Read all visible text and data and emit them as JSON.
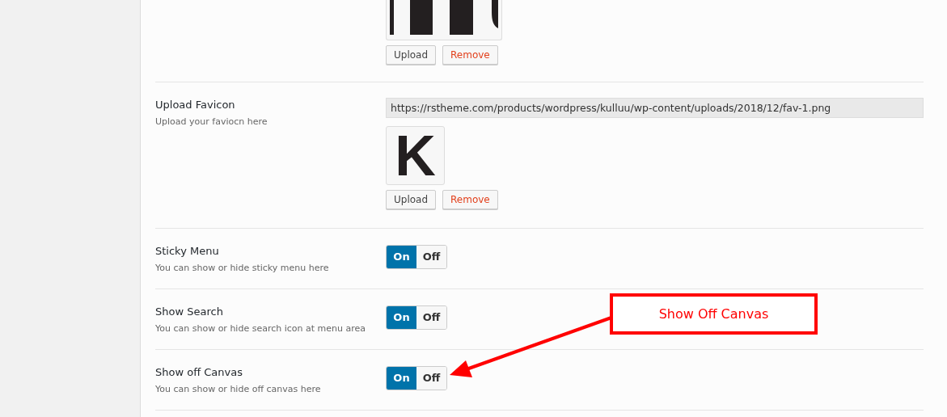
{
  "logo_upload": {
    "buttons": [
      {
        "label": "Upload",
        "kind": "upload"
      },
      {
        "label": "Remove",
        "kind": "remove"
      }
    ]
  },
  "favicon_upload": {
    "title": "Upload Favicon",
    "description": "Upload your faviocn here",
    "value": "https://rstheme.com/products/wordpress/kulluu/wp-content/uploads/2018/12/fav-1.png",
    "preview_letter": "K",
    "buttons": [
      {
        "label": "Upload",
        "kind": "upload"
      },
      {
        "label": "Remove",
        "kind": "remove"
      }
    ]
  },
  "switches": [
    {
      "title": "Sticky Menu",
      "description": "You can show or hide sticky menu here",
      "options": [
        {
          "label": "On",
          "selected": true
        },
        {
          "label": "Off",
          "selected": false
        }
      ]
    },
    {
      "title": "Show Search",
      "description": "You can show or hide search icon at menu area",
      "options": [
        {
          "label": "On",
          "selected": true
        },
        {
          "label": "Off",
          "selected": false
        }
      ]
    },
    {
      "title": "Show off Canvas",
      "description": "You can show or hide off canvas here",
      "options": [
        {
          "label": "On",
          "selected": true
        },
        {
          "label": "Off",
          "selected": false
        }
      ]
    }
  ],
  "annotation": {
    "label": "Show Off Canvas"
  }
}
